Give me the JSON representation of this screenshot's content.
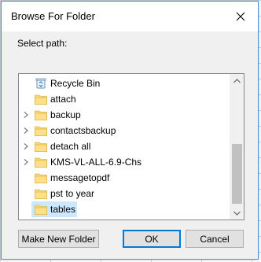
{
  "window": {
    "title": "Browse For Folder",
    "prompt": "Select path:"
  },
  "tree": {
    "items": [
      {
        "label": "Recycle Bin",
        "icon": "recycle-bin-icon",
        "expandable": false,
        "selected": false
      },
      {
        "label": "attach",
        "icon": "folder-icon",
        "expandable": false,
        "selected": false
      },
      {
        "label": "backup",
        "icon": "folder-icon",
        "expandable": true,
        "selected": false
      },
      {
        "label": "contactsbackup",
        "icon": "folder-icon",
        "expandable": true,
        "selected": false
      },
      {
        "label": "detach all",
        "icon": "folder-icon",
        "expandable": true,
        "selected": false
      },
      {
        "label": "KMS-VL-ALL-6.9-Chs",
        "icon": "folder-icon",
        "expandable": true,
        "selected": false
      },
      {
        "label": "messagetopdf",
        "icon": "folder-icon",
        "expandable": false,
        "selected": false
      },
      {
        "label": "pst to year",
        "icon": "folder-icon",
        "expandable": false,
        "selected": false
      },
      {
        "label": "tables",
        "icon": "folder-icon",
        "expandable": false,
        "selected": true
      }
    ]
  },
  "buttons": {
    "new_folder": "Make New Folder",
    "ok": "OK",
    "cancel": "Cancel"
  },
  "colors": {
    "folder": "#f8d775",
    "selection": "#cce8ff",
    "accent": "#0078d7"
  }
}
